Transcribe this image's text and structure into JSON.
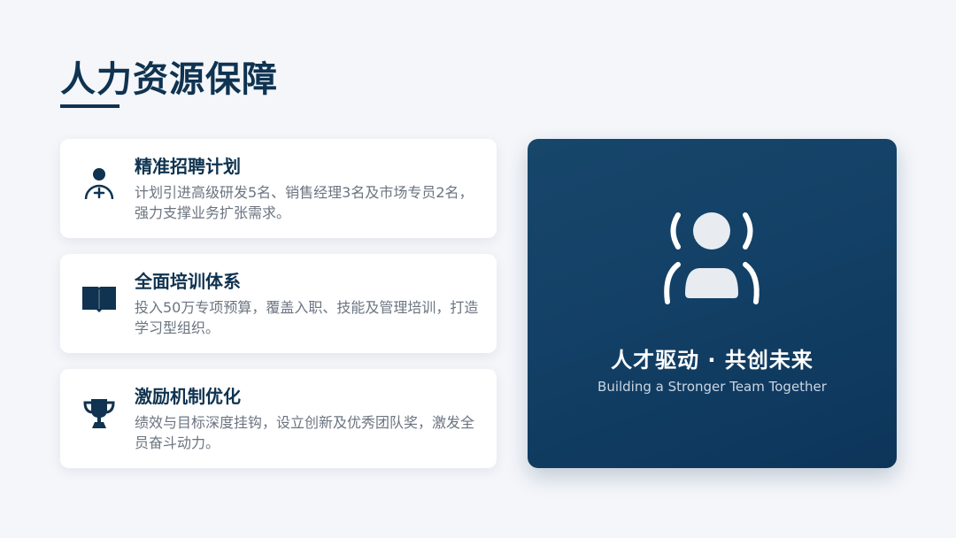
{
  "page": {
    "title": "人力资源保障"
  },
  "cards": [
    {
      "icon": "user-add-icon",
      "heading": "精准招聘计划",
      "description": "计划引进高级研发5名、销售经理3名及市场专员2名，强力支撑业务扩张需求。"
    },
    {
      "icon": "book-icon",
      "heading": "全面培训体系",
      "description": "投入50万专项预算，覆盖入职、技能及管理培训，打造学习型组织。"
    },
    {
      "icon": "trophy-icon",
      "heading": "激励机制优化",
      "description": "绩效与目标深度挂钩，设立创新及优秀团队奖，激发全员奋斗动力。"
    }
  ],
  "hero": {
    "icon": "person-icon",
    "title": "人才驱动 · 共创未来",
    "subtitle": "Building a Stronger Team Together"
  },
  "colors": {
    "primary": "#0f3350",
    "background": "#f4f6fa",
    "hero_gradient_start": "#17466b",
    "hero_gradient_end": "#0d355a",
    "text_muted": "#6b7480"
  }
}
